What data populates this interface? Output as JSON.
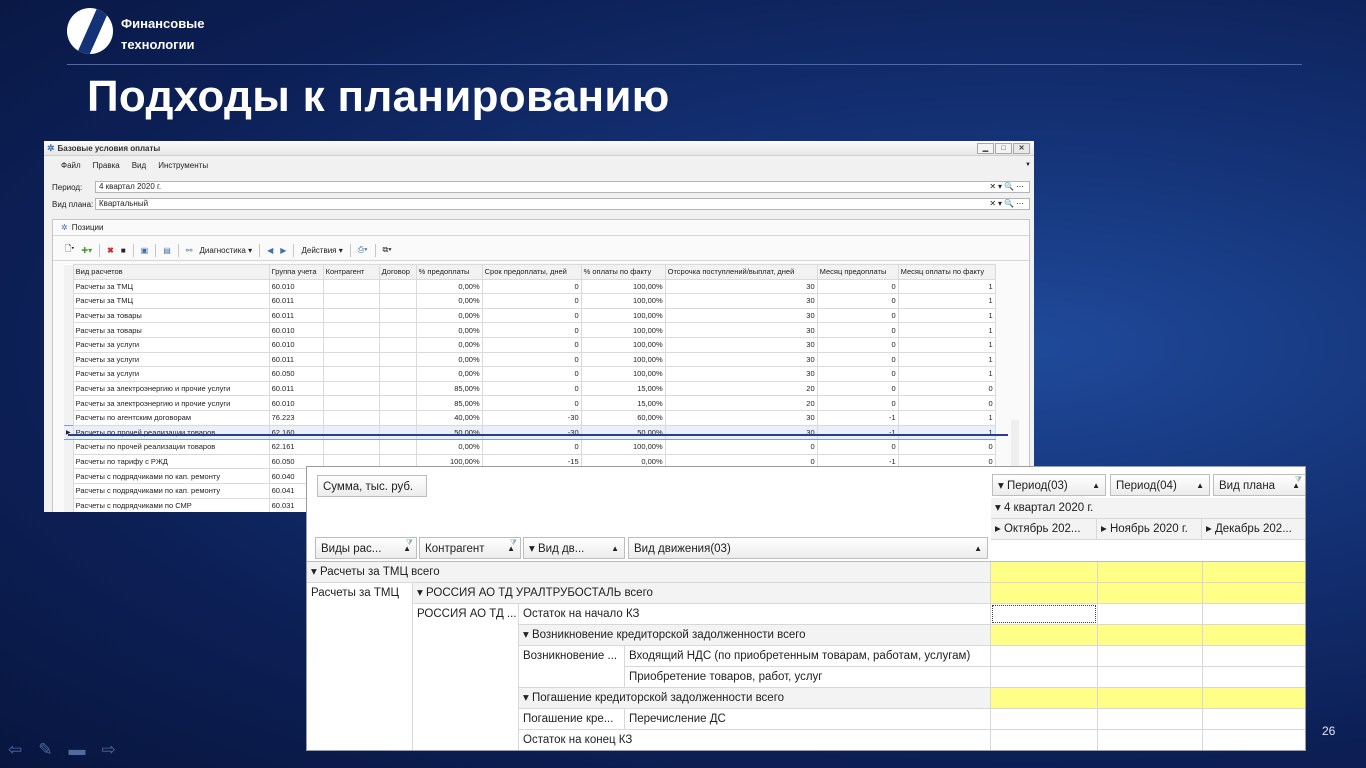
{
  "slide": {
    "brand": [
      "Финансовые",
      "технологии"
    ],
    "title": "Подходы к планированию",
    "page_number": "26"
  },
  "window": {
    "title": "Базовые условия оплаты",
    "menu": [
      "Файл",
      "Правка",
      "Вид",
      "Инструменты"
    ],
    "period_label": "Период:",
    "period_value": "4 квартал 2020 г.",
    "plan_type_label": "Вид плана:",
    "plan_type_value": "Квартальный",
    "positions_label": "Позиции",
    "toolbar": {
      "diagnostics": "Диагностика",
      "actions": "Действия"
    },
    "columns": [
      "Вид расчетов",
      "Группа учета",
      "Контрагент",
      "Договор",
      "% предоплаты",
      "Срок предоплаты, дней",
      "% оплаты по факту",
      "Отсрочка поступлений/выплат, дней",
      "Месяц предоплаты",
      "Месяц оплаты по факту"
    ],
    "rows": [
      [
        "Расчеты за ТМЦ",
        "60.010",
        "",
        "",
        "0,00%",
        "0",
        "100,00%",
        "30",
        "0",
        "1"
      ],
      [
        "Расчеты за ТМЦ",
        "60.011",
        "",
        "",
        "0,00%",
        "0",
        "100,00%",
        "30",
        "0",
        "1"
      ],
      [
        "Расчеты за товары",
        "60.011",
        "",
        "",
        "0,00%",
        "0",
        "100,00%",
        "30",
        "0",
        "1"
      ],
      [
        "Расчеты за товары",
        "60.010",
        "",
        "",
        "0,00%",
        "0",
        "100,00%",
        "30",
        "0",
        "1"
      ],
      [
        "Расчеты за услуги",
        "60.010",
        "",
        "",
        "0,00%",
        "0",
        "100,00%",
        "30",
        "0",
        "1"
      ],
      [
        "Расчеты за услуги",
        "60.011",
        "",
        "",
        "0,00%",
        "0",
        "100,00%",
        "30",
        "0",
        "1"
      ],
      [
        "Расчеты за услуги",
        "60.050",
        "",
        "",
        "0,00%",
        "0",
        "100,00%",
        "30",
        "0",
        "1"
      ],
      [
        "Расчеты за электроэнергию и прочие услуги",
        "60.011",
        "",
        "",
        "85,00%",
        "0",
        "15,00%",
        "20",
        "0",
        "0"
      ],
      [
        "Расчеты за электроэнергию и прочие услуги",
        "60.010",
        "",
        "",
        "85,00%",
        "0",
        "15,00%",
        "20",
        "0",
        "0"
      ],
      [
        "Расчеты по агентским договорам",
        "76.223",
        "",
        "",
        "40,00%",
        "-30",
        "60,00%",
        "30",
        "-1",
        "1"
      ],
      [
        "Расчеты по прочей реализации товаров",
        "62.160",
        "",
        "",
        "50,00%",
        "-30",
        "50,00%",
        "30",
        "-1",
        "1"
      ],
      [
        "Расчеты по прочей реализации товаров",
        "62.161",
        "",
        "",
        "0,00%",
        "0",
        "100,00%",
        "0",
        "0",
        "0"
      ],
      [
        "Расчеты по тарифу с РЖД",
        "60.050",
        "",
        "",
        "100,00%",
        "-15",
        "0,00%",
        "0",
        "-1",
        "0"
      ],
      [
        "Расчеты с подрядчиками по кап. ремонту",
        "60.040",
        "",
        "",
        "",
        "",
        "",
        "",
        "",
        ""
      ],
      [
        "Расчеты с подрядчиками по кап. ремонту",
        "60.041",
        "",
        "",
        "",
        "",
        "",
        "",
        "",
        ""
      ],
      [
        "Расчеты с подрядчиками по СМР",
        "60.031",
        "",
        "",
        "",
        "",
        "",
        "",
        "",
        ""
      ]
    ],
    "current_row_index": 10
  },
  "pivot": {
    "sum_label": "Сумма, тыс. руб.",
    "period03": "Период(03)",
    "period04": "Период(04)",
    "plan_type": "Вид плана",
    "quarter": "4 квартал 2020 г.",
    "months": [
      "Октябрь 202...",
      "Ноябрь 2020 г.",
      "Декабрь 202..."
    ],
    "row_fields": [
      "Виды рас...",
      "Контрагент",
      "Вид дв...",
      "Вид движения(03)"
    ],
    "r1": "Расчеты за ТМЦ всего",
    "r2a": "Расчеты за ТМЦ",
    "r2b": "РОССИЯ АО ТД УРАЛТРУБОСТАЛЬ всего",
    "r3a": "РОССИЯ АО ТД ...",
    "r3b": "Остаток на начало КЗ",
    "r4": "Возникновение кредиторской задолженности всего",
    "r5a": "Возникновение ...",
    "r5b": "Входящий НДС (по приобретенным товарам, работам, услугам)",
    "r6": "Приобретение товаров, работ, услуг",
    "r7": "Погашение кредиторской задолженности всего",
    "r8a": "Погашение кре...",
    "r8b": "Перечисление ДС",
    "r9": "Остаток на конец КЗ"
  }
}
